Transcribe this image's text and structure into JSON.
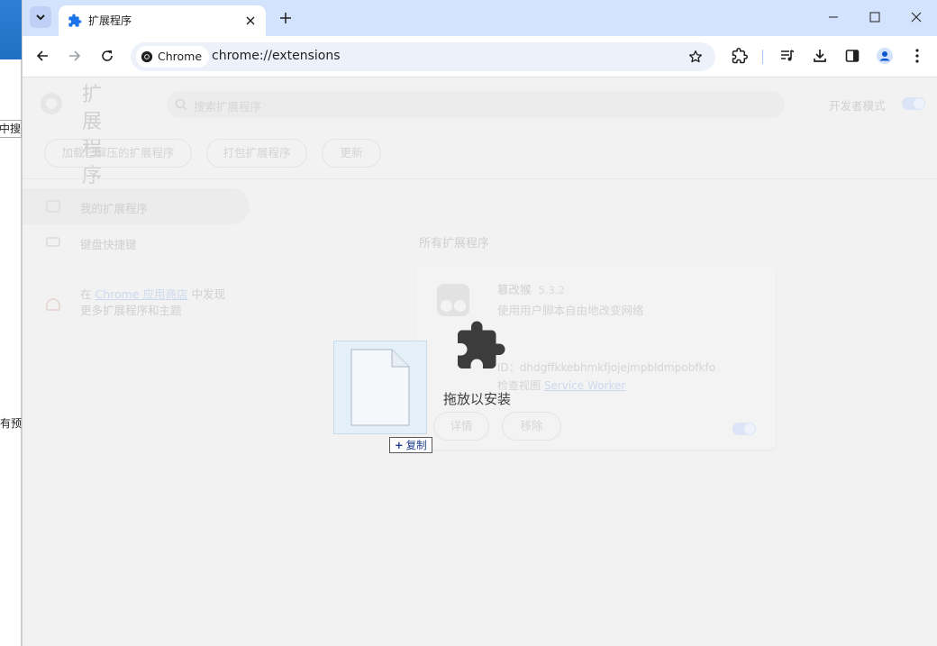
{
  "background_window": {
    "fragment_1": "中搜索",
    "fragment_2": "有预"
  },
  "tab": {
    "title": "扩展程序"
  },
  "toolbar": {
    "chip_label": "Chrome",
    "url": "chrome://extensions"
  },
  "page": {
    "title": "扩展程序",
    "search_placeholder": "搜索扩展程序",
    "developer_mode_label": "开发者模式",
    "buttons": {
      "load_unpacked": "加载已解压的扩展程序",
      "pack": "打包扩展程序",
      "update": "更新"
    },
    "nav": {
      "my_extensions": "我的扩展程序",
      "shortcuts": "键盘快捷键",
      "store_prefix": "在",
      "store_link": "Chrome 应用商店",
      "store_suffix": "中发现",
      "store_line2": "更多扩展程序和主题"
    },
    "section_title": "所有扩展程序",
    "extension": {
      "name": "篡改猴",
      "version": "5.3.2",
      "description": "使用用户脚本自由地改变网络",
      "id": "ID：dhdgffkkebhmkfjojejmpbldmpobfkfo",
      "inspect_label": "检查视图",
      "inspect_link": "Service Worker",
      "details": "详情",
      "remove": "移除",
      "enabled": true
    },
    "developer_mode": true
  },
  "overlay": {
    "drop_label": "拖放以安装",
    "copy_label": "复制"
  }
}
